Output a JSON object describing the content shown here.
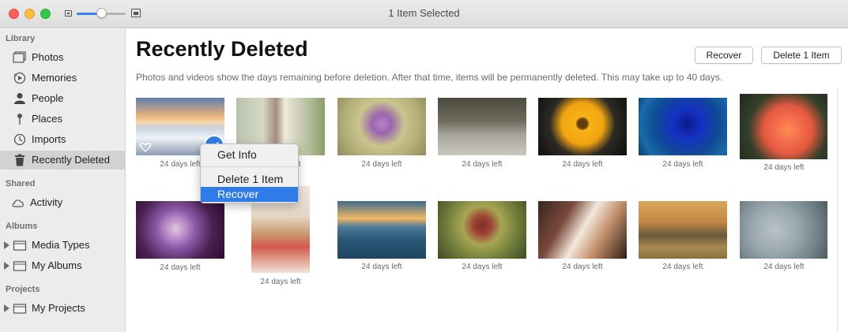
{
  "window": {
    "title": "1 Item Selected"
  },
  "toolbar": {
    "zoom_slider_value": 0.5
  },
  "sidebar": {
    "sections": [
      {
        "header": "Library",
        "items": [
          {
            "label": "Photos",
            "icon": "photos-icon"
          },
          {
            "label": "Memories",
            "icon": "memories-icon"
          },
          {
            "label": "People",
            "icon": "people-icon"
          },
          {
            "label": "Places",
            "icon": "places-icon"
          },
          {
            "label": "Imports",
            "icon": "imports-icon"
          },
          {
            "label": "Recently Deleted",
            "icon": "trash-icon",
            "selected": true
          }
        ]
      },
      {
        "header": "Shared",
        "items": [
          {
            "label": "Activity",
            "icon": "cloud-icon"
          }
        ]
      },
      {
        "header": "Albums",
        "items": [
          {
            "label": "Media Types",
            "icon": "folder-icon"
          },
          {
            "label": "My Albums",
            "icon": "folder-icon"
          }
        ]
      },
      {
        "header": "Projects",
        "items": [
          {
            "label": "My Projects",
            "icon": "folder-icon"
          }
        ]
      }
    ]
  },
  "main": {
    "title": "Recently Deleted",
    "recover_label": "Recover",
    "delete_label": "Delete 1 Item",
    "description": "Photos and videos show the days remaining before deletion. After that time, items will be permanently deleted. This may take up to 40 days.",
    "photos": [
      {
        "caption": "24 days left",
        "subject": "snowy mountains at sunset",
        "selected": true,
        "favorite": true
      },
      {
        "caption": "24 days left",
        "subject": "ostrich"
      },
      {
        "caption": "24 days left",
        "subject": "purple clover flower with bee"
      },
      {
        "caption": "24 days left",
        "subject": "deer in field"
      },
      {
        "caption": "24 days left",
        "subject": "yellow flower"
      },
      {
        "caption": "24 days left",
        "subject": "blue rose"
      },
      {
        "caption": "24 days left",
        "subject": "orange roses"
      },
      {
        "caption": "24 days left",
        "subject": "purple daisy"
      },
      {
        "caption": "24 days left",
        "subject": "strawberries"
      },
      {
        "caption": "24 days left",
        "subject": "ocean waves at sunset"
      },
      {
        "caption": "24 days left",
        "subject": "red flower bud"
      },
      {
        "caption": "24 days left",
        "subject": "white flower"
      },
      {
        "caption": "24 days left",
        "subject": "rhinoceros"
      },
      {
        "caption": "24 days left",
        "subject": "kingfisher bird"
      }
    ]
  },
  "context_menu": {
    "items": [
      {
        "label": "Get Info"
      },
      {
        "label": "Delete 1 Item"
      },
      {
        "label": "Recover",
        "highlighted": true
      }
    ]
  },
  "colors": {
    "accent": "#2f7ce8",
    "sidebar_bg": "#ececec",
    "selection_bg": "#d2d2d2"
  }
}
